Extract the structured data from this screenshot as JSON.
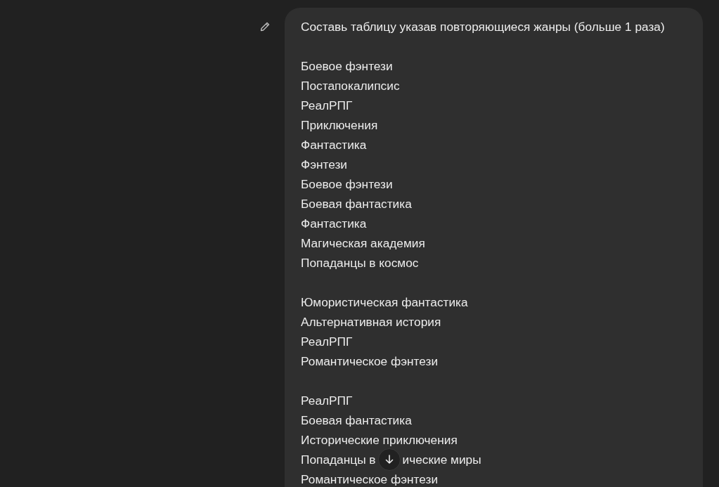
{
  "message": {
    "first_line": "Составь таблицу указав повторяющиеся жанры (больше 1 раза)",
    "groups": [
      [
        {
          "kind": "text",
          "text": "Боевое фэнтези"
        },
        {
          "kind": "text",
          "text": "Постапокалипсис"
        },
        {
          "kind": "text",
          "text": "РеалРПГ"
        },
        {
          "kind": "text",
          "text": "Приключения"
        },
        {
          "kind": "text",
          "text": "Фантастика"
        },
        {
          "kind": "text",
          "text": "Фэнтези"
        },
        {
          "kind": "text",
          "text": "Боевое фэнтези"
        },
        {
          "kind": "text",
          "text": "Боевая фантастика"
        },
        {
          "kind": "text",
          "text": "Фантастика"
        },
        {
          "kind": "text",
          "text": "Магическая академия"
        },
        {
          "kind": "text",
          "text": "Попаданцы в космос"
        }
      ],
      [
        {
          "kind": "text",
          "text": "Юмористическая фантастика"
        },
        {
          "kind": "text",
          "text": "Альтернативная история"
        },
        {
          "kind": "text",
          "text": "РеалРПГ"
        },
        {
          "kind": "text",
          "text": "Романтическое фэнтези"
        }
      ],
      [
        {
          "kind": "text",
          "text": "РеалРПГ"
        },
        {
          "kind": "text",
          "text": "Боевая фантастика"
        },
        {
          "kind": "text",
          "text": "Исторические приключения"
        },
        {
          "kind": "occluded",
          "parts": [
            "Попаданцы в",
            "ические миры"
          ]
        },
        {
          "kind": "text",
          "text": "Романтическое фэнтези"
        }
      ]
    ]
  }
}
